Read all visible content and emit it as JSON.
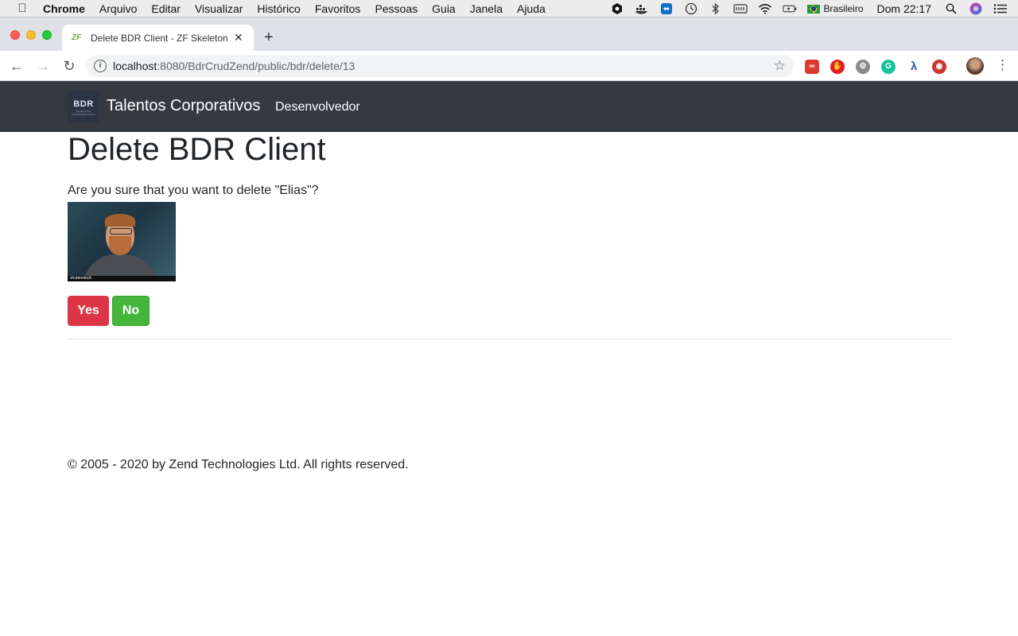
{
  "menubar": {
    "app_name": "Chrome",
    "items": [
      "Arquivo",
      "Editar",
      "Visualizar",
      "Histórico",
      "Favoritos",
      "Pessoas",
      "Guia",
      "Janela",
      "Ajuda"
    ],
    "input_source": "Brasileiro",
    "clock": "Dom 22:17"
  },
  "browser": {
    "tab_title": "Delete BDR Client - ZF Skeleton",
    "url_host": "localhost",
    "url_path": ":8080/BdrCrudZend/public/bdr/delete/13"
  },
  "navbar": {
    "logo_text": "BDR",
    "logo_subtext": "TALENTOS CORPORATIVOS",
    "brand": "Talentos Corporativos",
    "link": "Desenvolvedor"
  },
  "page": {
    "heading": "Delete BDR Client",
    "question": "Are you sure that you want to delete \"Elias\"?",
    "photo_watermark": "shutterstock",
    "yes_label": "Yes",
    "no_label": "No",
    "footer": "© 2005 - 2020 by Zend Technologies Ltd. All rights reserved."
  },
  "colors": {
    "navbar_bg": "#343a40",
    "danger": "#dc3545",
    "success": "#45b53b"
  }
}
